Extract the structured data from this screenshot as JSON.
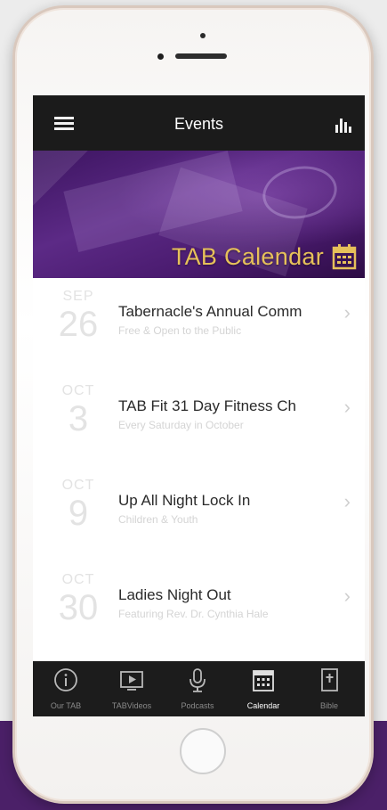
{
  "navbar": {
    "title": "Events"
  },
  "banner": {
    "title": "TAB Calendar"
  },
  "events": [
    {
      "month": "SEP",
      "day": "26",
      "title": "Tabernacle's Annual Comm",
      "subtitle": "Free & Open to the Public"
    },
    {
      "month": "OCT",
      "day": "3",
      "title": "TAB Fit 31 Day Fitness Ch",
      "subtitle": "Every Saturday in October"
    },
    {
      "month": "OCT",
      "day": "9",
      "title": "Up All Night Lock In",
      "subtitle": "Children & Youth"
    },
    {
      "month": "OCT",
      "day": "30",
      "title": "Ladies Night Out",
      "subtitle": "Featuring Rev. Dr. Cynthia Hale"
    }
  ],
  "tabs": [
    {
      "label": "Our TAB",
      "icon": "info-icon"
    },
    {
      "label": "TABVideos",
      "icon": "video-icon"
    },
    {
      "label": "Podcasts",
      "icon": "microphone-icon"
    },
    {
      "label": "Calendar",
      "icon": "calendar-icon"
    },
    {
      "label": "Bible",
      "icon": "bible-icon"
    }
  ],
  "colors": {
    "accent_gold": "#e6c05a",
    "purple": "#4b2068",
    "bar_dark": "#1b1b1b"
  }
}
